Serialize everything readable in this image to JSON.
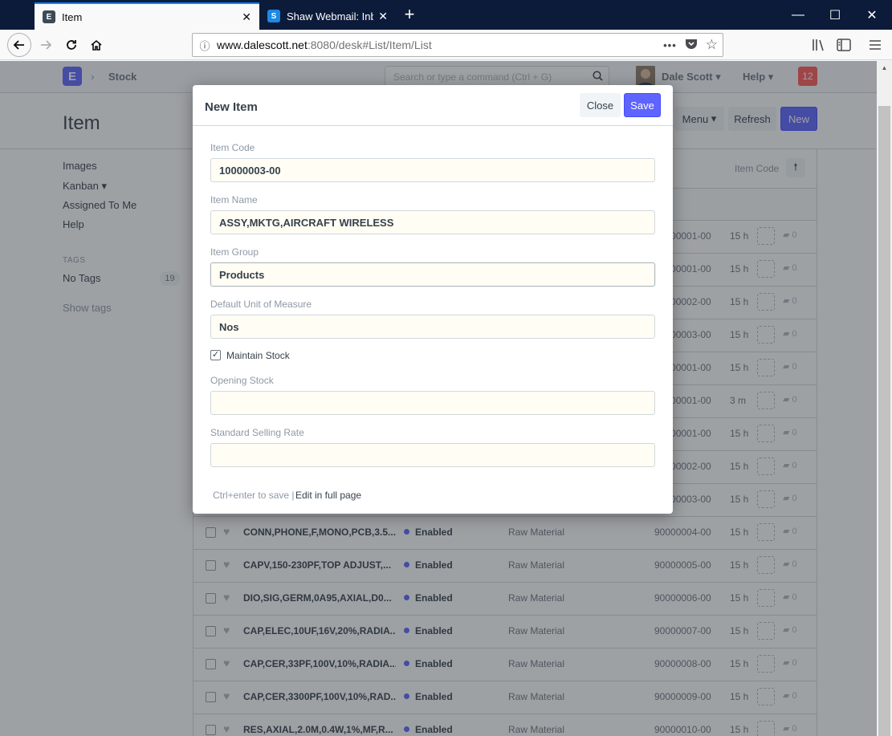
{
  "browser": {
    "tabs": [
      {
        "title": "Item",
        "favicon": "E",
        "active": true
      },
      {
        "title": "Shaw Webmail: Inbox",
        "favicon": "S",
        "active": false
      }
    ],
    "url_host": "www.dalescott.net",
    "url_rest": ":8080/desk#List/Item/List"
  },
  "app": {
    "logo": "E",
    "breadcrumb": "Stock",
    "search_placeholder": "Search or type a command (Ctrl + G)",
    "user": "Dale Scott",
    "help": "Help",
    "notifications": "12",
    "page_title": "Item",
    "buttons": {
      "menu": "Menu",
      "refresh": "Refresh",
      "new": "New"
    }
  },
  "sidebar": {
    "items": [
      "Images",
      "Kanban",
      "Assigned To Me",
      "Help"
    ],
    "tags_label": "TAGS",
    "no_tags": "No Tags",
    "no_tags_count": "19",
    "show_tags": "Show tags"
  },
  "list": {
    "sort_label": "Item Code",
    "rows": [
      {
        "title": "",
        "status": "",
        "group": "",
        "code": "90000001-00",
        "time": "15 h",
        "comments": "0"
      },
      {
        "title": "",
        "status": "",
        "group": "",
        "code": "90000001-00",
        "time": "15 h",
        "comments": "0"
      },
      {
        "title": "",
        "status": "",
        "group": "",
        "code": "90000002-00",
        "time": "15 h",
        "comments": "0"
      },
      {
        "title": "",
        "status": "",
        "group": "",
        "code": "90000003-00",
        "time": "15 h",
        "comments": "0"
      },
      {
        "title": "",
        "status": "",
        "group": "",
        "code": "90000001-00",
        "time": "15 h",
        "comments": "0"
      },
      {
        "title": "",
        "status": "",
        "group": "",
        "code": "90000001-00",
        "time": "3 m",
        "comments": "0"
      },
      {
        "title": "",
        "status": "",
        "group": "",
        "code": "90000001-00",
        "time": "15 h",
        "comments": "0"
      },
      {
        "title": "",
        "status": "",
        "group": "",
        "code": "90000002-00",
        "time": "15 h",
        "comments": "0"
      },
      {
        "title": "",
        "status": "",
        "group": "",
        "code": "90000003-00",
        "time": "15 h",
        "comments": "0"
      },
      {
        "title": "CONN,PHONE,F,MONO,PCB,3.5...",
        "status": "Enabled",
        "group": "Raw Material",
        "code": "90000004-00",
        "time": "15 h",
        "comments": "0"
      },
      {
        "title": "CAPV,150-230PF,TOP ADJUST,...",
        "status": "Enabled",
        "group": "Raw Material",
        "code": "90000005-00",
        "time": "15 h",
        "comments": "0"
      },
      {
        "title": "DIO,SIG,GERM,0A95,AXIAL,D0...",
        "status": "Enabled",
        "group": "Raw Material",
        "code": "90000006-00",
        "time": "15 h",
        "comments": "0"
      },
      {
        "title": "CAP,ELEC,10UF,16V,20%,RADIA...",
        "status": "Enabled",
        "group": "Raw Material",
        "code": "90000007-00",
        "time": "15 h",
        "comments": "0"
      },
      {
        "title": "CAP,CER,33PF,100V,10%,RADIA...",
        "status": "Enabled",
        "group": "Raw Material",
        "code": "90000008-00",
        "time": "15 h",
        "comments": "0"
      },
      {
        "title": "CAP,CER,3300PF,100V,10%,RAD...",
        "status": "Enabled",
        "group": "Raw Material",
        "code": "90000009-00",
        "time": "15 h",
        "comments": "0"
      },
      {
        "title": "RES,AXIAL,2.0M,0.4W,1%,MF,R...",
        "status": "Enabled",
        "group": "Raw Material",
        "code": "90000010-00",
        "time": "15 h",
        "comments": "0"
      }
    ]
  },
  "modal": {
    "title": "New Item",
    "close": "Close",
    "save": "Save",
    "fields": {
      "item_code": {
        "label": "Item Code",
        "value": "10000003-00"
      },
      "item_name": {
        "label": "Item Name",
        "value": "ASSY,MKTG,AIRCRAFT WIRELESS"
      },
      "item_group": {
        "label": "Item Group",
        "value": "Products"
      },
      "uom": {
        "label": "Default Unit of Measure",
        "value": "Nos"
      },
      "opening_stock": {
        "label": "Opening Stock",
        "value": ""
      },
      "selling_rate": {
        "label": "Standard Selling Rate",
        "value": ""
      }
    },
    "maintain_stock": {
      "label": "Maintain Stock",
      "checked": true
    },
    "footer_hint": "Ctrl+enter to save |",
    "edit_full_page": "Edit in full page"
  },
  "colors": {
    "primary": "#5e64ff",
    "notification": "#ff5858",
    "tabbar": "#0c1b3a"
  }
}
